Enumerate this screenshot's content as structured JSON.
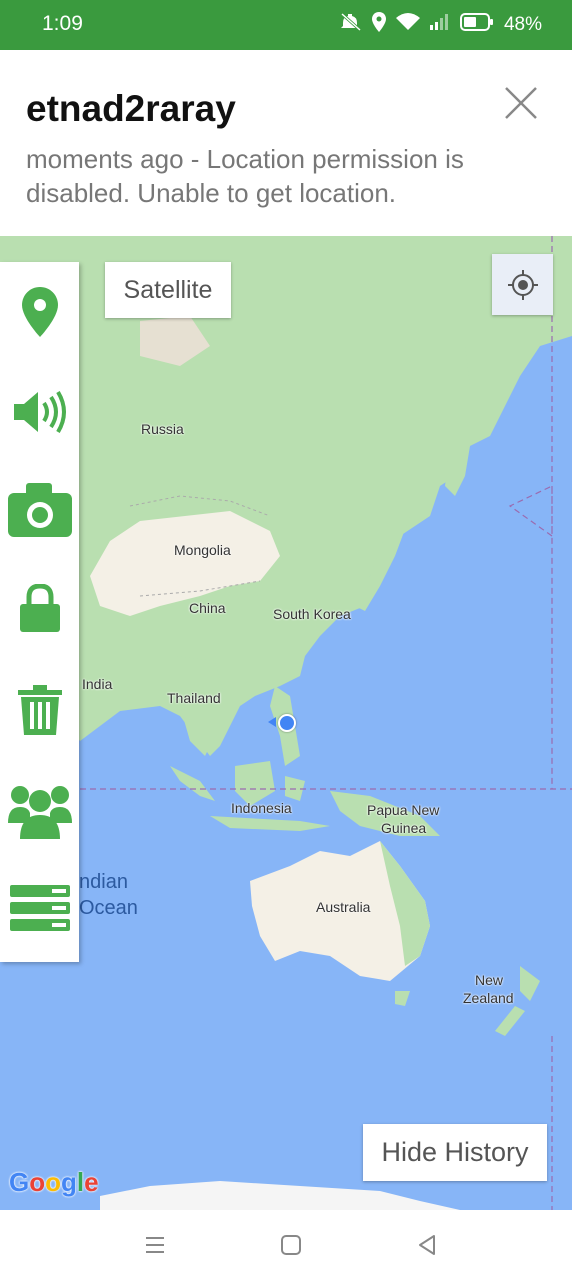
{
  "status_bar": {
    "time": "1:09",
    "battery": "48%"
  },
  "header": {
    "device_name": "etnad2raray",
    "message": "moments ago - Location permission is disabled. Unable to get location."
  },
  "map": {
    "satellite_label": "Satellite",
    "hide_history_label": "Hide History",
    "labels": {
      "russia": "Russia",
      "mongolia": "Mongolia",
      "china": "China",
      "south_korea": "South Korea",
      "india": "India",
      "thailand": "Thailand",
      "indonesia": "Indonesia",
      "papua_line1": "Papua New",
      "papua_line2": "Guinea",
      "australia": "Australia",
      "nz_line1": "New",
      "nz_line2": "Zealand",
      "ocean_line1": "ndian",
      "ocean_line2": "Ocean"
    },
    "google_letters": [
      "G",
      "o",
      "o",
      "g",
      "l",
      "e"
    ],
    "google_colors": [
      "#4285f4",
      "#ea4335",
      "#fbbc05",
      "#4285f4",
      "#34a853",
      "#ea4335"
    ]
  },
  "toolbar": {
    "icons": [
      "location-pin-icon",
      "speaker-icon",
      "camera-icon",
      "lock-icon",
      "trash-icon",
      "group-icon",
      "list-icon"
    ]
  },
  "colors": {
    "accent": "#3a9a3e",
    "icon_green": "#4caf50",
    "land": "#b9dfb0",
    "desert": "#f4f0e6",
    "water": "#87b5f7"
  }
}
